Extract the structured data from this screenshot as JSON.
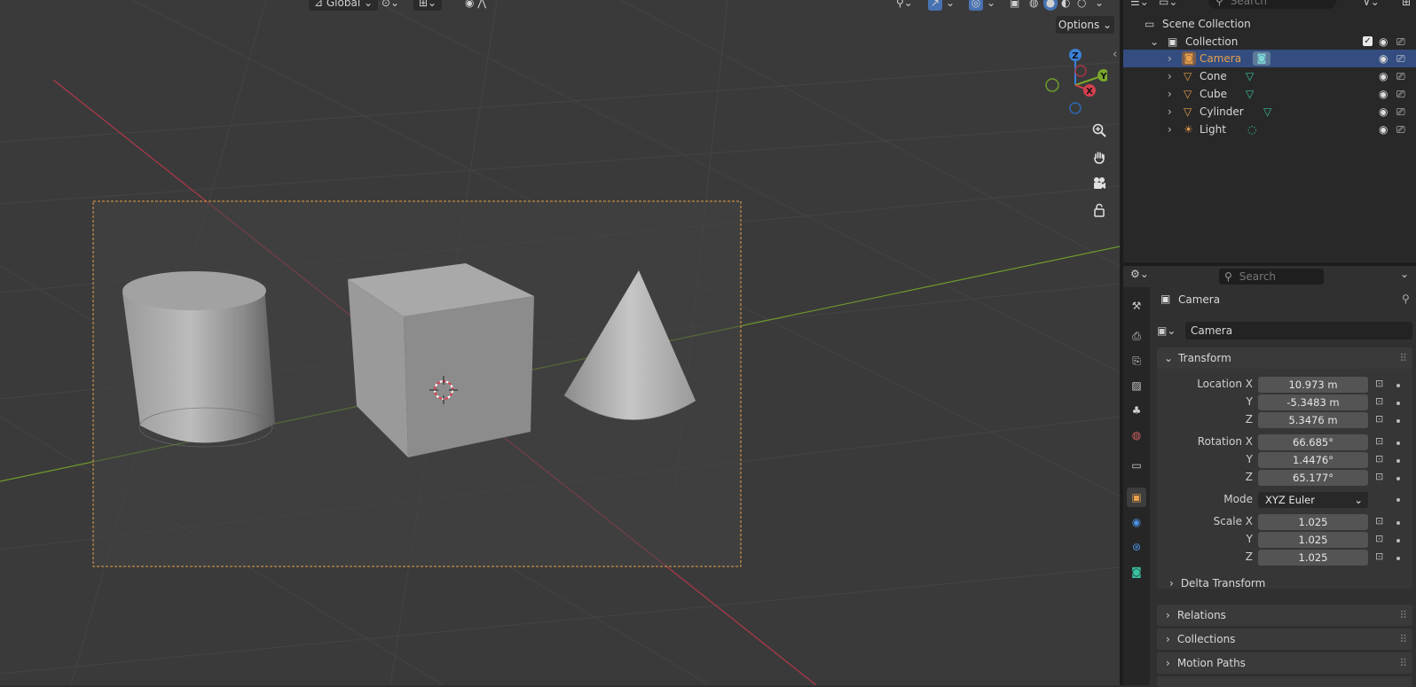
{
  "viewport": {
    "transform_orientation": "Global",
    "options_label": "Options",
    "gizmo": {
      "z": "Z",
      "y": "Y",
      "x": "X"
    }
  },
  "outliner": {
    "search_placeholder": "Search",
    "scene_collection": "Scene Collection",
    "collection": "Collection",
    "objects": [
      {
        "name": "Camera",
        "type": "camera",
        "selected": true
      },
      {
        "name": "Cone",
        "type": "mesh",
        "selected": false
      },
      {
        "name": "Cube",
        "type": "mesh",
        "selected": false
      },
      {
        "name": "Cylinder",
        "type": "mesh",
        "selected": false
      },
      {
        "name": "Light",
        "type": "light",
        "selected": false
      }
    ]
  },
  "properties": {
    "search_placeholder": "Search",
    "context_title": "Camera",
    "object_name": "Camera",
    "transform": {
      "header": "Transform",
      "location_label": "Location X",
      "location": [
        "10.973 m",
        "-5.3483 m",
        "5.3476 m"
      ],
      "rotation_label": "Rotation X",
      "rotation": [
        "66.685°",
        "1.4476°",
        "65.177°"
      ],
      "mode_label": "Mode",
      "mode_value": "XYZ Euler",
      "scale_label": "Scale X",
      "scale": [
        "1.025",
        "1.025",
        "1.025"
      ],
      "axis_y": "Y",
      "axis_z": "Z"
    },
    "delta_transform": "Delta Transform",
    "panels": [
      "Relations",
      "Collections",
      "Motion Paths"
    ]
  },
  "colors": {
    "accent_orange": "#e8a04a",
    "selection_blue": "#334d80",
    "axis_x": "#d5404f",
    "axis_y": "#7ba72c",
    "axis_z": "#3a80d8"
  }
}
